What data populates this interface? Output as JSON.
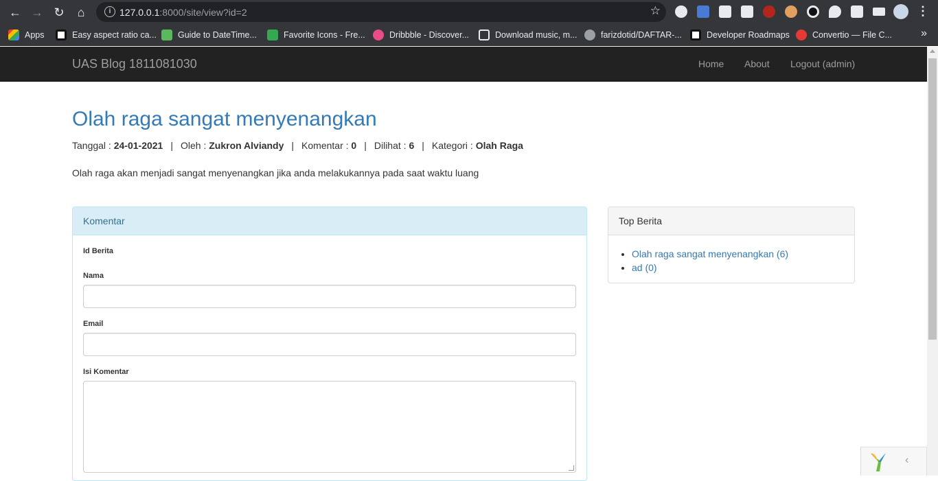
{
  "browser": {
    "url_host": "127.0.0.1",
    "url_rest": ":8000/site/view?id=2",
    "bookmarks": [
      {
        "label": "Apps",
        "color": "#4285f4"
      },
      {
        "label": "Easy aspect ratio ca...",
        "color": "#111111"
      },
      {
        "label": "Guide to DateTime...",
        "color": "#5cb85c"
      },
      {
        "label": "Favorite Icons - Fre...",
        "color": "#34a853"
      },
      {
        "label": "Dribbble - Discover...",
        "color": "#ea4c89"
      },
      {
        "label": "Download music, m...",
        "color": "#e8eaed"
      },
      {
        "label": "farizdotid/DAFTAR-...",
        "color": "#e8eaed"
      },
      {
        "label": "Developer Roadmaps",
        "color": "#111111"
      },
      {
        "label": "Convertio — File C...",
        "color": "#e53935"
      }
    ]
  },
  "navbar": {
    "brand": "UAS Blog 1811081030",
    "links": [
      "Home",
      "About",
      "Logout (admin)"
    ]
  },
  "post": {
    "title": "Olah raga sangat menyenangkan",
    "meta": {
      "tanggal_label": "Tanggal :",
      "tanggal": "24-01-2021",
      "oleh_label": "Oleh :",
      "oleh": "Zukron Alviandy",
      "komentar_label": "Komentar :",
      "komentar": "0",
      "dilihat_label": "Dilihat :",
      "dilihat": "6",
      "kategori_label": "Kategori :",
      "kategori": "Olah Raga",
      "separator": "|"
    },
    "body": "Olah raga akan menjadi sangat menyenangkan jika anda melakukannya pada saat waktu luang"
  },
  "komentar_panel": {
    "heading": "Komentar",
    "fields": {
      "id_berita": "Id Berita",
      "nama": "Nama",
      "email": "Email",
      "isi": "Isi Komentar"
    }
  },
  "top_berita": {
    "heading": "Top Berita",
    "items": [
      "Olah raga sangat menyenangkan (6)",
      "ad (0)"
    ]
  },
  "colors": {
    "link": "#337ab7",
    "navbar": "#222222",
    "info_panel": "#d9edf7"
  }
}
